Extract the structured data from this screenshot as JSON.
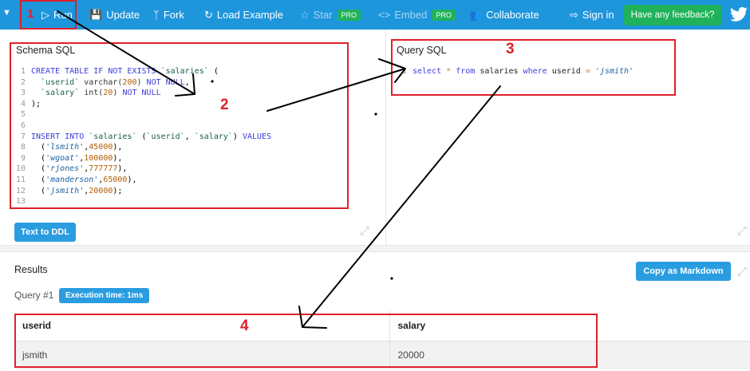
{
  "topbar": {
    "run_label": "Run",
    "update_label": "Update",
    "fork_label": "Fork",
    "load_example_label": "Load Example",
    "star_label": "Star",
    "star_badge": "PRO",
    "embed_label": "Embed",
    "embed_badge": "PRO",
    "collaborate_label": "Collaborate",
    "sign_in_label": "Sign in",
    "feedback_label": "Have any feedback?"
  },
  "schema": {
    "title": "Schema SQL",
    "button_label": "Text to DDL"
  },
  "query": {
    "title": "Query SQL"
  },
  "results": {
    "title": "Results",
    "copy_label": "Copy as Markdown",
    "query_label": "Query #1",
    "exec_time": "Execution time: 1ms",
    "columns": [
      "userid",
      "salary"
    ],
    "rows": [
      [
        "jsmith",
        "20000"
      ]
    ]
  },
  "annotations": {
    "labels": [
      "1",
      "2",
      "3",
      "4"
    ],
    "color": "#e0202a"
  },
  "colors": {
    "topbar": "#1e96dc",
    "accent_button": "#2a9de0",
    "pro_badge": "#1fb25a"
  }
}
